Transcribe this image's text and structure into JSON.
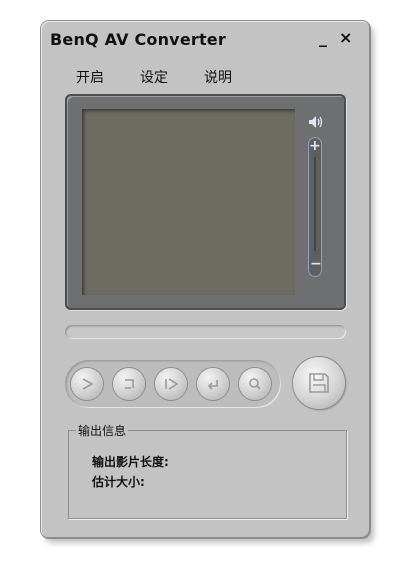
{
  "window": {
    "title": "BenQ AV Converter",
    "minimize_label": "_",
    "close_label": "×"
  },
  "menu": {
    "items": [
      "开启",
      "设定",
      "说明"
    ]
  },
  "info": {
    "group_title": "输出信息",
    "length_label": "输出影片长度:",
    "size_label": "估计大小:"
  },
  "icons": {
    "controls": [
      "play-icon",
      "stop-icon",
      "next-icon",
      "back-icon",
      "search-icon"
    ],
    "save": "floppy-icon",
    "volume": "speaker-icon"
  },
  "colors": {
    "window_bg": "#c3c3c3",
    "screen_bg": "#6d6b62",
    "frame": "#6e6f71"
  }
}
